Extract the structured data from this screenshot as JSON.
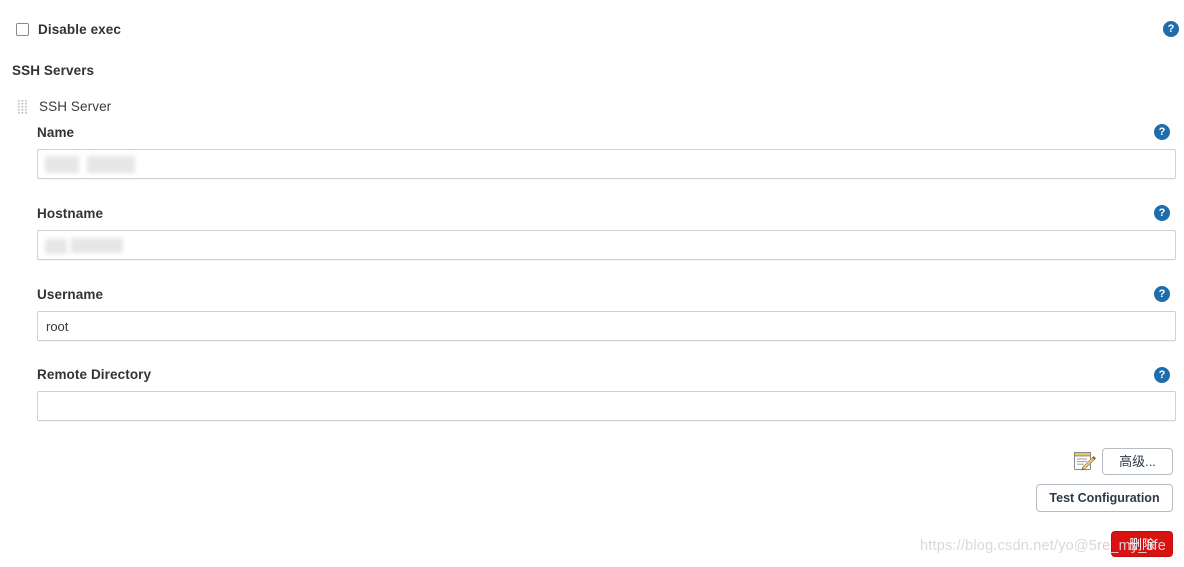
{
  "top_option": {
    "label": "Disable exec",
    "checked": false,
    "help_icon": "help-icon"
  },
  "section": {
    "title": "SSH Servers"
  },
  "server": {
    "header_label": "SSH Server",
    "grip_icon": "drag-handle-icon",
    "fields": [
      {
        "label": "Name",
        "value": "",
        "redacted": true,
        "help_icon": "help-icon"
      },
      {
        "label": "Hostname",
        "value": "",
        "redacted": true,
        "help_icon": "help-icon"
      },
      {
        "label": "Username",
        "value": "root",
        "redacted": false,
        "help_icon": "help-icon"
      },
      {
        "label": "Remote Directory",
        "value": "",
        "redacted": false,
        "help_icon": "help-icon"
      }
    ]
  },
  "actions": {
    "notes_icon": "notepad-edit-icon",
    "advanced_label": "高级...",
    "test_label": "Test Configuration",
    "delete_label": "删除"
  },
  "watermark": {
    "prefix": "https://blog.csdn.net/yo@5",
    "overlap": "re_my_",
    "suffix": "life"
  },
  "colors": {
    "help_blue": "#1f6eab",
    "delete_red": "#d81111",
    "border_gray": "#d0d0d0",
    "text": "#333333"
  }
}
